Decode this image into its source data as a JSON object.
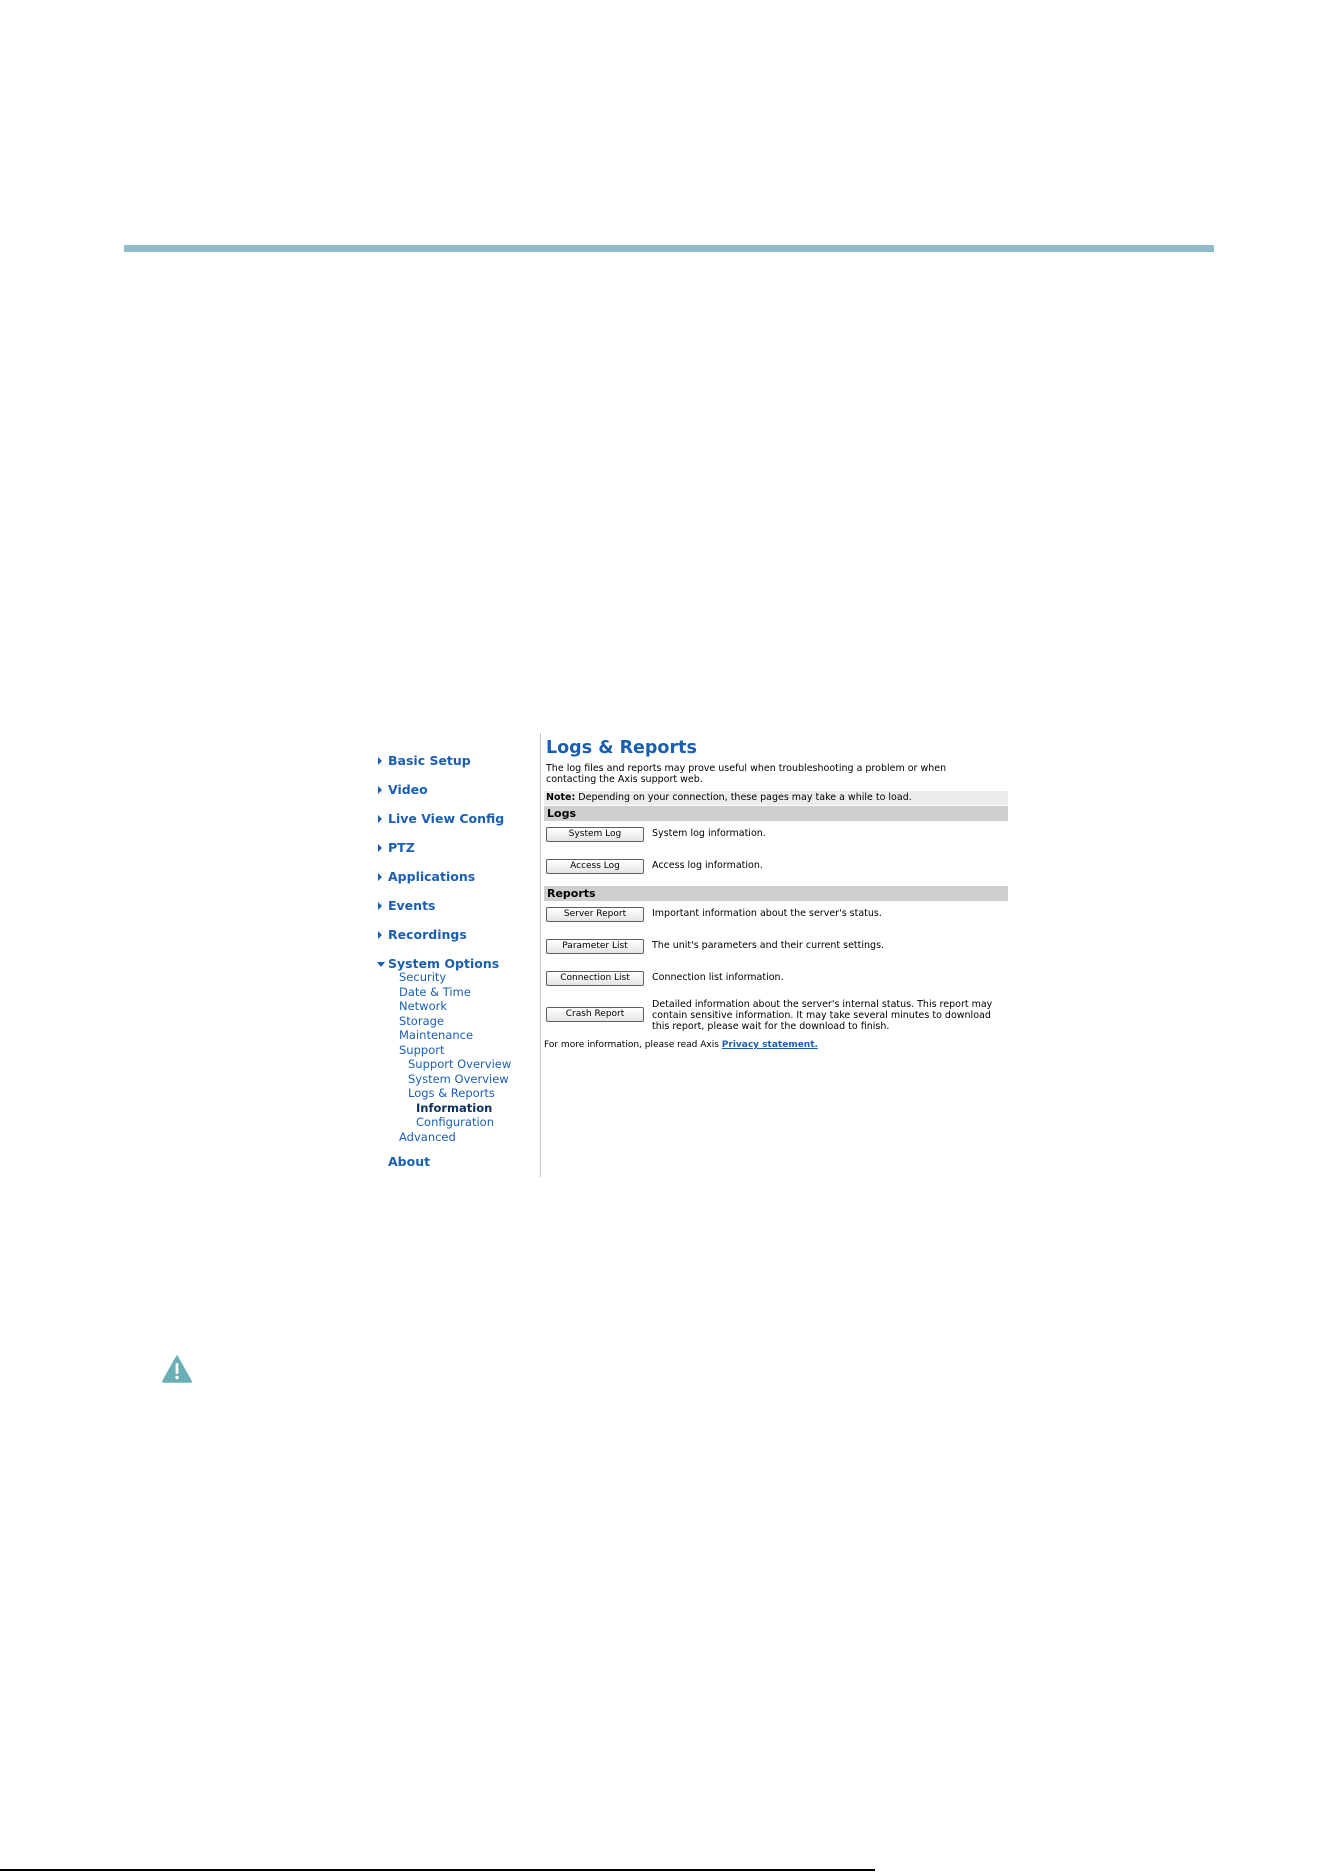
{
  "nav": {
    "items": [
      {
        "label": "Basic Setup"
      },
      {
        "label": "Video"
      },
      {
        "label": "Live View Config"
      },
      {
        "label": "PTZ"
      },
      {
        "label": "Applications"
      },
      {
        "label": "Events"
      },
      {
        "label": "Recordings"
      }
    ],
    "system_options": {
      "label": "System Options",
      "security": "Security",
      "date_time": "Date & Time",
      "network": "Network",
      "storage": "Storage",
      "maintenance": "Maintenance",
      "support": "Support",
      "support_overview": "Support Overview",
      "system_overview": "System Overview",
      "logs_reports": "Logs & Reports",
      "information": "Information",
      "configuration": "Configuration",
      "advanced": "Advanced"
    },
    "about": "About"
  },
  "main": {
    "title": "Logs & Reports",
    "intro": "The log files and reports may prove useful when troubleshooting a problem or when contacting the Axis support web.",
    "note_label": "Note:",
    "note_text": " Depending on your connection, these pages may take a while to load.",
    "logs_heading": "Logs",
    "reports_heading": "Reports",
    "rows": [
      {
        "button": "System Log",
        "desc": "System log information."
      },
      {
        "button": "Access Log",
        "desc": "Access log information."
      },
      {
        "button": "Server Report",
        "desc": "Important information about the server's status."
      },
      {
        "button": "Parameter List",
        "desc": "The unit's parameters and their current settings."
      },
      {
        "button": "Connection List",
        "desc": "Connection list information."
      },
      {
        "button": "Crash Report",
        "desc": "Detailed information about the server's internal status. This report may contain sensitive information. It may take several minutes to download this report, please wait for the download to finish."
      }
    ],
    "footnote_text": "For more information, please read Axis ",
    "footnote_link": "Privacy statement."
  },
  "colors": {
    "rule": "#8fbcc9",
    "link": "#1b5fb3",
    "warning": "#6aaeb8"
  },
  "icons": [
    "caret-right-icon",
    "caret-down-icon",
    "warning-icon"
  ]
}
